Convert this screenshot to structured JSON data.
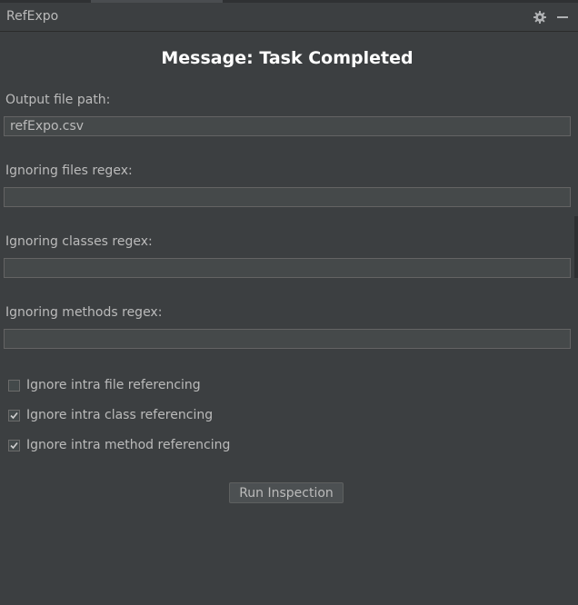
{
  "window": {
    "title": "RefExpo",
    "icons": {
      "settings": "gear-icon",
      "minimize": "minimize-icon"
    }
  },
  "heading": "Message: Task Completed",
  "fields": {
    "output_path": {
      "label": "Output file path:",
      "value": "refExpo.csv"
    },
    "ignore_files": {
      "label": "Ignoring files regex:",
      "value": ""
    },
    "ignore_classes": {
      "label": "Ignoring classes regex:",
      "value": ""
    },
    "ignore_methods": {
      "label": "Ignoring methods regex:",
      "value": ""
    }
  },
  "options": {
    "intra_file": {
      "label": "Ignore intra file referencing",
      "checked": false
    },
    "intra_class": {
      "label": "Ignore intra class referencing",
      "checked": true
    },
    "intra_method": {
      "label": "Ignore intra method referencing",
      "checked": true
    }
  },
  "actions": {
    "run_label": "Run Inspection"
  },
  "colors": {
    "background": "#3c3f41",
    "field_background": "#45494a",
    "field_border": "#646464",
    "text": "#bbbbbb",
    "heading_text": "#ffffff"
  }
}
